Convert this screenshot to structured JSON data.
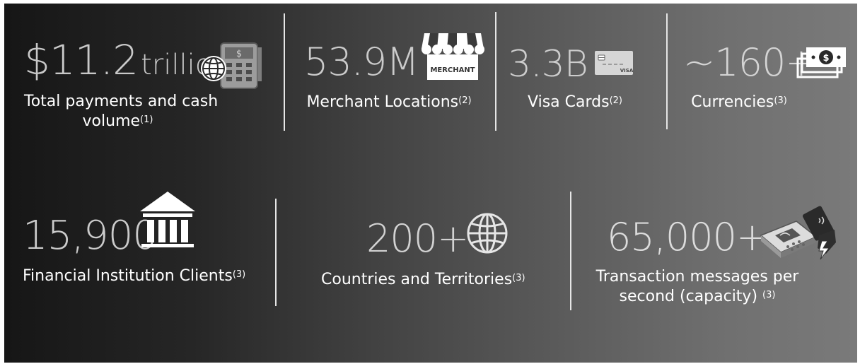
{
  "stats": [
    {
      "value": "$11.2",
      "unit": "trillion",
      "label": "Total payments and cash",
      "label2": "volume",
      "note": "(1)",
      "icon": "payment-terminal-globe-icon"
    },
    {
      "value": "53.9M",
      "label": "Merchant Locations",
      "note": "(2)",
      "icon": "storefront-icon",
      "icon_text": "MERCHANT"
    },
    {
      "value": "3.3B",
      "label": "Visa Cards",
      "note": "(2)",
      "icon": "visa-card-icon",
      "icon_text": "VISA"
    },
    {
      "value": "~160+",
      "label": "Currencies",
      "note": "(3)",
      "icon": "banknotes-icon"
    },
    {
      "value": "15,900",
      "label": "Financial Institution Clients",
      "note": "(3)",
      "icon": "bank-building-icon"
    },
    {
      "value": "200+",
      "label": "Countries and Territories",
      "note": "(3)",
      "icon": "globe-icon"
    },
    {
      "value": "65,000+",
      "label": "Transaction messages per",
      "label2": "second (capacity)",
      "note": "(3)",
      "icon": "contactless-terminal-icon"
    }
  ],
  "colors": {
    "value_dark": "#c9c9c9",
    "value_light": "#e2e2e2",
    "label": "#ffffff"
  }
}
